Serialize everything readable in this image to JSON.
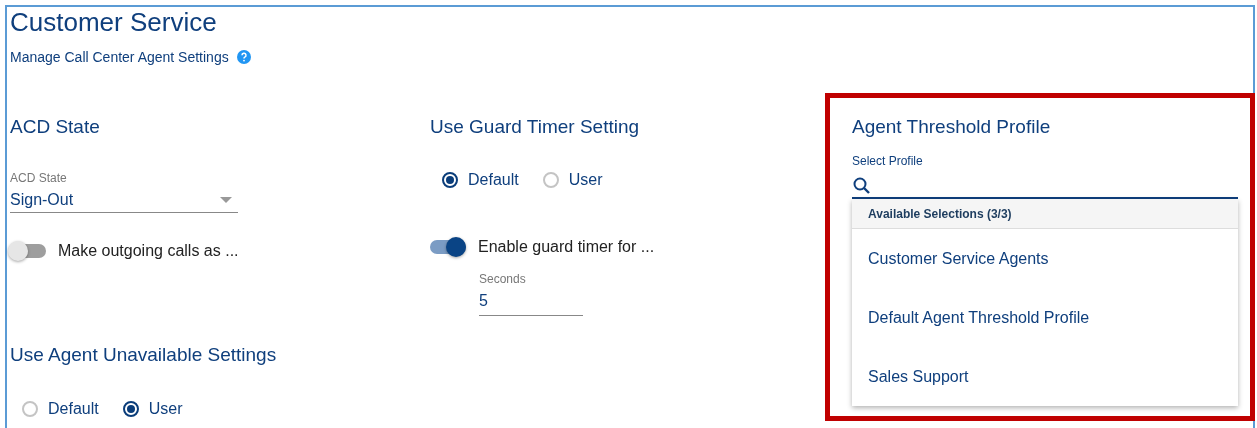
{
  "page": {
    "title": "Customer Service",
    "subtitle": "Manage Call Center Agent Settings"
  },
  "acd_state": {
    "heading": "ACD State",
    "field_label": "ACD State",
    "value": "Sign-Out",
    "toggle": {
      "label": "Make outgoing calls as ...",
      "on": false
    }
  },
  "agent_unavailable": {
    "heading": "Use Agent Unavailable Settings",
    "options": [
      {
        "label": "Default",
        "selected": false
      },
      {
        "label": "User",
        "selected": true
      }
    ]
  },
  "guard_timer": {
    "heading": "Use Guard Timer Setting",
    "options": [
      {
        "label": "Default",
        "selected": true
      },
      {
        "label": "User",
        "selected": false
      }
    ],
    "toggle": {
      "label": "Enable guard timer for ...",
      "on": true
    },
    "seconds": {
      "label": "Seconds",
      "value": "5"
    }
  },
  "threshold_profile": {
    "highlighted": true,
    "heading": "Agent Threshold Profile",
    "field_label": "Select Profile",
    "dropdown_header": "Available Selections (3/3)",
    "items": [
      {
        "label": "Customer Service Agents"
      },
      {
        "label": "Default Agent Threshold Profile"
      },
      {
        "label": "Sales Support"
      }
    ]
  }
}
